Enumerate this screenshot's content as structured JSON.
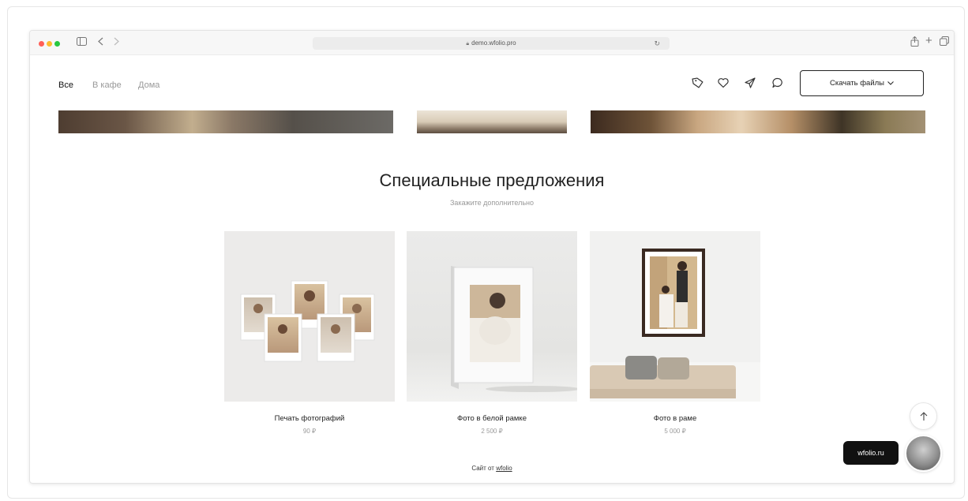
{
  "browser": {
    "url": "demo.wfolio.pro",
    "icons": [
      "sidebar-icon",
      "back-icon",
      "forward-icon",
      "lock-icon",
      "reload-icon",
      "share-icon",
      "new-tab-icon",
      "tabs-icon"
    ]
  },
  "nav": {
    "tabs": [
      {
        "label": "Все",
        "active": true
      },
      {
        "label": "В кафе",
        "active": false
      },
      {
        "label": "Дома",
        "active": false
      }
    ],
    "icons": [
      "tag-icon",
      "heart-icon",
      "send-icon",
      "comment-icon"
    ],
    "download_label": "Скачать файлы"
  },
  "section": {
    "title": "Специальные предложения",
    "subtitle": "Закажите дополнительно"
  },
  "products": [
    {
      "name": "Печать фотографий",
      "price": "90 ₽"
    },
    {
      "name": "Фото в белой рамке",
      "price": "2 500 ₽"
    },
    {
      "name": "Фото в раме",
      "price": "5 000 ₽"
    }
  ],
  "footer": {
    "prefix": "Сайт от",
    "link": "wfolio"
  },
  "widgets": {
    "badge": "wfolio.ru"
  },
  "colors": {
    "accent": "#111111",
    "text": "#222222",
    "muted": "#999999"
  }
}
